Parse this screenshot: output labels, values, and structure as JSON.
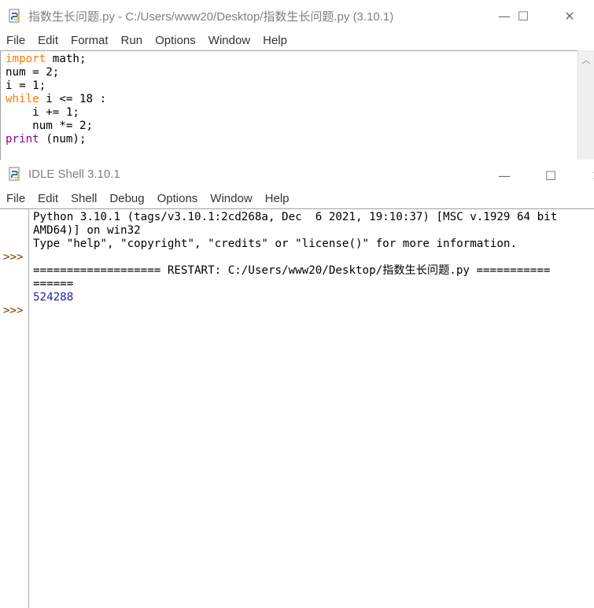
{
  "editor": {
    "title": "指数生长问题.py - C:/Users/www20/Desktop/指数生长问题.py (3.10.1)",
    "menu": [
      "File",
      "Edit",
      "Format",
      "Run",
      "Options",
      "Window",
      "Help"
    ],
    "code_lines": [
      [
        {
          "t": "import",
          "c": "kw"
        },
        {
          "t": " math;",
          "c": ""
        }
      ],
      [
        {
          "t": "num = 2;",
          "c": ""
        }
      ],
      [
        {
          "t": "i = 1;",
          "c": ""
        }
      ],
      [
        {
          "t": "while",
          "c": "kw"
        },
        {
          "t": " i <= 18 :",
          "c": ""
        }
      ],
      [
        {
          "t": "    i += 1;",
          "c": ""
        }
      ],
      [
        {
          "t": "    num *= 2;",
          "c": ""
        }
      ],
      [
        {
          "t": "print",
          "c": "builtin"
        },
        {
          "t": " (num);",
          "c": ""
        }
      ]
    ]
  },
  "shell": {
    "title": "IDLE Shell 3.10.1",
    "menu": [
      "File",
      "Edit",
      "Shell",
      "Debug",
      "Options",
      "Window",
      "Help"
    ],
    "lines": [
      {
        "text": "Python 3.10.1 (tags/v3.10.1:2cd268a, Dec  6 2021, 19:10:37) [MSC v.1929 64 bit",
        "c": ""
      },
      {
        "text": "AMD64)] on win32",
        "c": ""
      },
      {
        "text": "Type \"help\", \"copyright\", \"credits\" or \"license()\" for more information.",
        "c": ""
      },
      {
        "text": "",
        "c": ""
      },
      {
        "text": "=================== RESTART: C:/Users/www20/Desktop/指数生长问题.py ===========",
        "c": ""
      },
      {
        "text": "======",
        "c": ""
      },
      {
        "text": "524288",
        "c": "out"
      }
    ],
    "prompt": ">>>",
    "prompt_rows": [
      3,
      7
    ]
  },
  "controls": {
    "minimize": "—",
    "maximize": "☐",
    "close": "✕"
  }
}
